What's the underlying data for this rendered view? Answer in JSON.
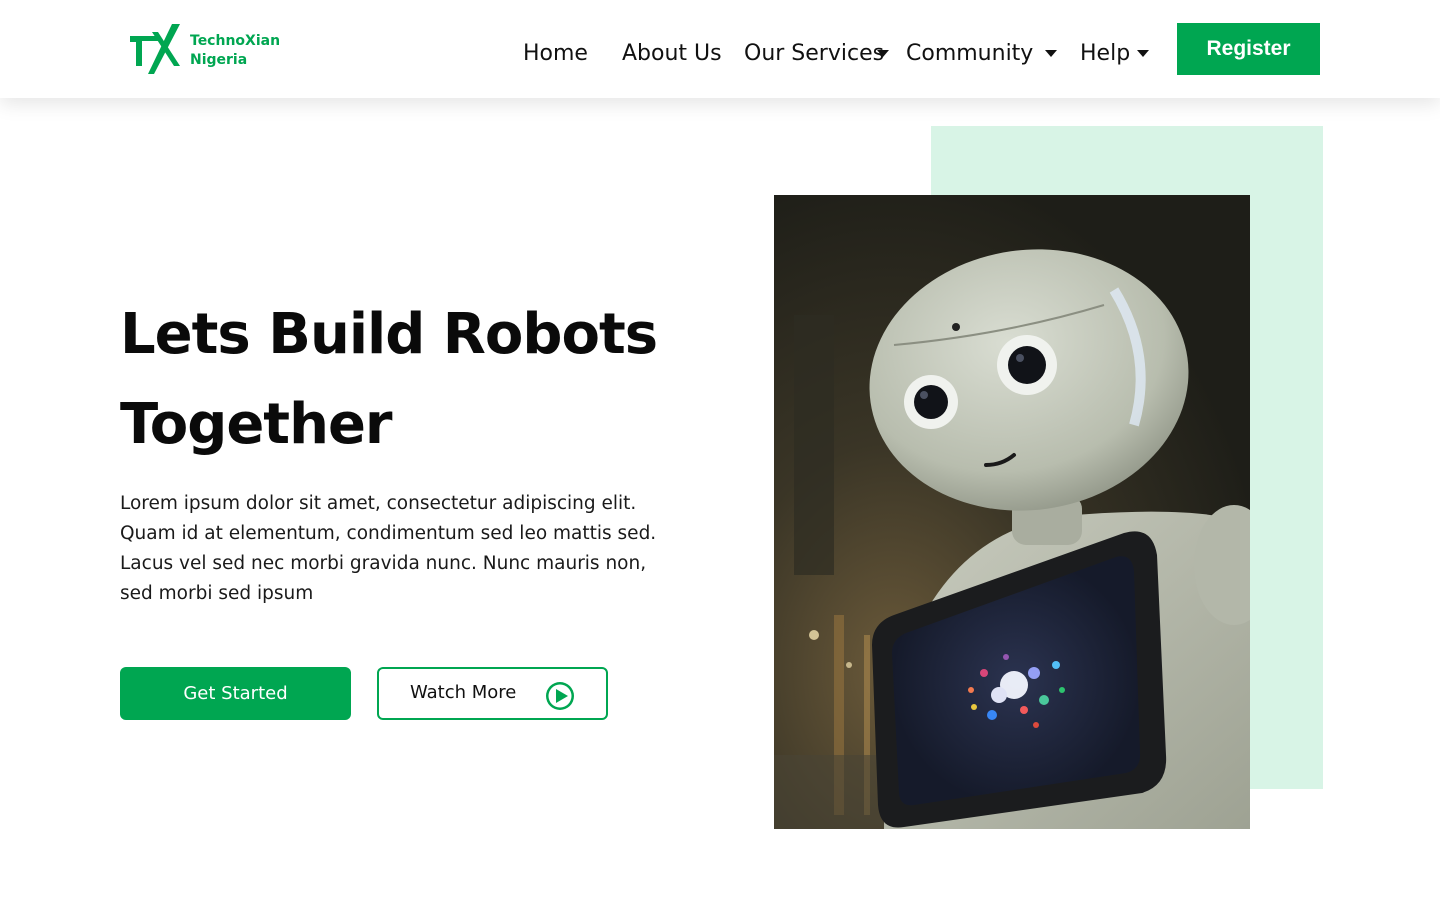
{
  "brand": {
    "name_line1": "TechnoXian",
    "name_line2": "Nigeria",
    "monogram": "TX",
    "accent_color": "#00a651",
    "mint_color": "#d8f4e6"
  },
  "nav": {
    "items": [
      {
        "label": "Home",
        "has_dropdown": false
      },
      {
        "label": "About Us",
        "has_dropdown": false
      },
      {
        "label": "Our Services",
        "has_dropdown": true
      },
      {
        "label": "Community",
        "has_dropdown": true
      },
      {
        "label": "Help",
        "has_dropdown": true
      }
    ],
    "register_label": "Register"
  },
  "hero": {
    "title_line1": "Lets Build Robots",
    "title_line2": "Together",
    "description": "Lorem ipsum dolor sit amet, consectetur adipiscing elit. Quam id at elementum, condimentum sed leo mattis sed. Lacus vel sed nec morbi gravida nunc. Nunc mauris non, sed morbi sed ipsum",
    "primary_cta": "Get Started",
    "secondary_cta": "Watch More",
    "secondary_icon": "play-circle-icon",
    "image_subject": "humanoid-robot-photo"
  }
}
